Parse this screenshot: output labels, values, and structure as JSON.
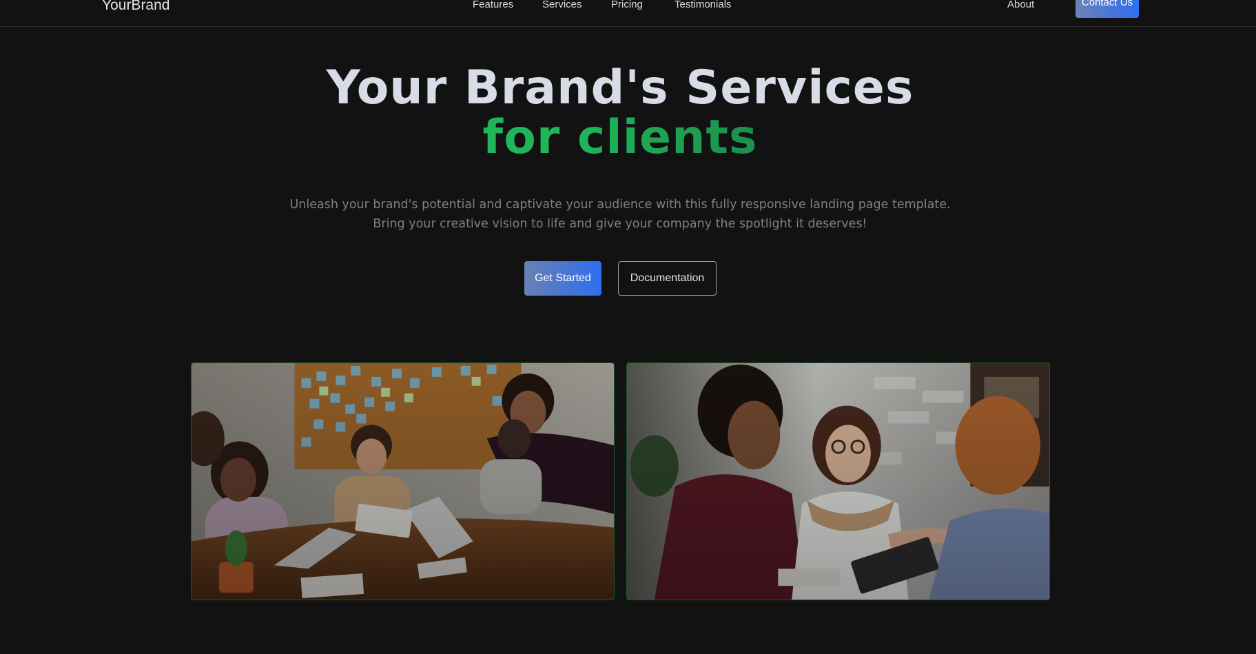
{
  "nav": {
    "brand": "YourBrand",
    "links": [
      "Features",
      "Services",
      "Pricing",
      "Testimonials"
    ],
    "about": "About",
    "contact": "Contact Us"
  },
  "hero": {
    "title_line1": "Your Brand's Services",
    "title_accent_a": "for",
    "title_accent_b": "clients",
    "subtitle_line1": "Unleash your brand's potential and captivate your audience with this fully responsive landing page template.",
    "subtitle_line2": "Bring your creative vision to life and give your company the spotlight it deserves!",
    "primary_button": "Get Started",
    "secondary_button": "Documentation"
  },
  "colors": {
    "background": "#121212",
    "accent_green": "#1fb55a",
    "accent_blue": "#2f6df0",
    "image_border": "#1c5a2c"
  },
  "images": [
    {
      "subject": "team meeting around a wooden table with laptops and sticky-note corkboard"
    },
    {
      "subject": "woman with glasses presenting to colleagues in a bright office"
    }
  ]
}
